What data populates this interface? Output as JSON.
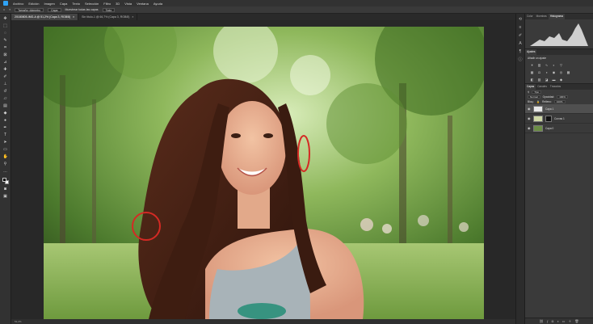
{
  "menubar": {
    "items": [
      "Archivo",
      "Edición",
      "Imagen",
      "Capa",
      "Texto",
      "Selección",
      "Filtro",
      "3D",
      "Vista",
      "Ventana",
      "Ayuda"
    ]
  },
  "options": {
    "tamano_label": "Tamaño: diámetro",
    "capa_value": "Capa",
    "muestra_label": "Muestrear todas las capas",
    "zoom_value": "Todo"
  },
  "doctabs": [
    {
      "label": "20180805-IMG-A @ 51,2% (Capa 3, RGB/8)",
      "close": "×"
    },
    {
      "label": "Sin título-1 @ 66,7% (Capa 3, RGB/8)",
      "close": "×"
    }
  ],
  "status": {
    "zoom": "51,2%"
  },
  "panels": {
    "top_tabs": [
      "Color",
      "Muestras",
      "Histograma"
    ],
    "adjust_tabs": [
      "Ajustes"
    ],
    "adjust_title": "Añadir un ajuste",
    "layer_tabs": [
      "Capas",
      "Canales",
      "Trazados"
    ],
    "filter_label": "Tipo",
    "blend_mode": "Normal",
    "opacity_label": "Opacidad:",
    "opacity_value": "100%",
    "lock_label": "Bloq.:",
    "fill_label": "Relleno:",
    "fill_value": "100%",
    "layers": [
      {
        "name": "Capa 1",
        "active": true
      },
      {
        "name": "Curvas 1",
        "active": false
      },
      {
        "name": "Capa 0",
        "active": false
      }
    ]
  },
  "colors": {
    "accent": "#2fa3f7",
    "annotation": "#d42a24"
  }
}
